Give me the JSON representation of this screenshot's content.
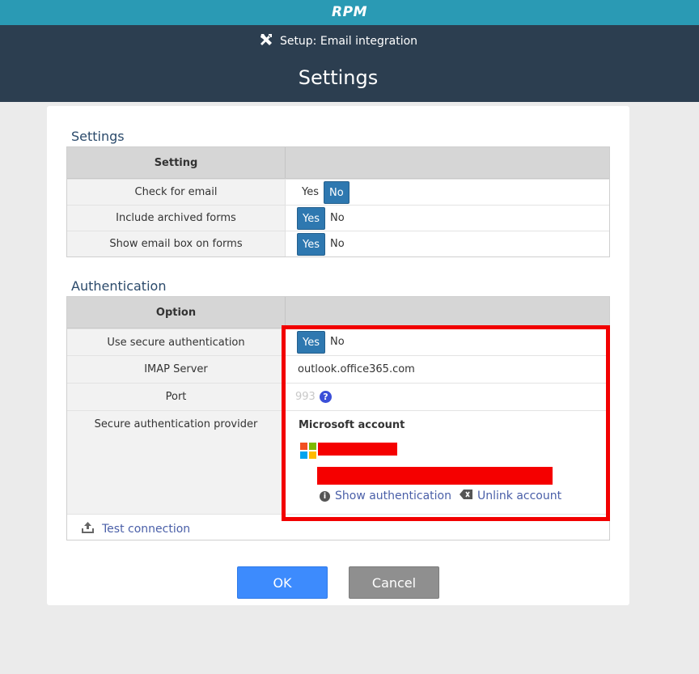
{
  "app": {
    "brand": "RPM"
  },
  "header": {
    "breadcrumb": "Setup: Email integration",
    "title": "Settings"
  },
  "settings": {
    "section_title": "Settings",
    "column_header": "Setting",
    "rows": [
      {
        "label": "Check for email",
        "yes": "Yes",
        "no": "No",
        "selected": "No"
      },
      {
        "label": "Include archived forms",
        "yes": "Yes",
        "no": "No",
        "selected": "Yes"
      },
      {
        "label": "Show email box on forms",
        "yes": "Yes",
        "no": "No",
        "selected": "Yes"
      }
    ]
  },
  "auth": {
    "section_title": "Authentication",
    "column_header": "Option",
    "secure_label": "Use secure authentication",
    "secure_yes": "Yes",
    "secure_no": "No",
    "secure_selected": "Yes",
    "imap_label": "IMAP Server",
    "imap_value": "outlook.office365.com",
    "port_label": "Port",
    "port_placeholder": "993",
    "provider_label": "Secure authentication provider",
    "provider_name": "Microsoft account",
    "show_auth": "Show authentication",
    "unlink": "Unlink account",
    "test_connection": "Test connection"
  },
  "buttons": {
    "ok": "OK",
    "cancel": "Cancel"
  },
  "colors": {
    "topbar": "#2a9ab4",
    "header": "#2c3e50",
    "toggle_on": "#2e78b0",
    "ok": "#3d8bfd",
    "cancel": "#8f8f8f",
    "highlight": "#f20000"
  }
}
